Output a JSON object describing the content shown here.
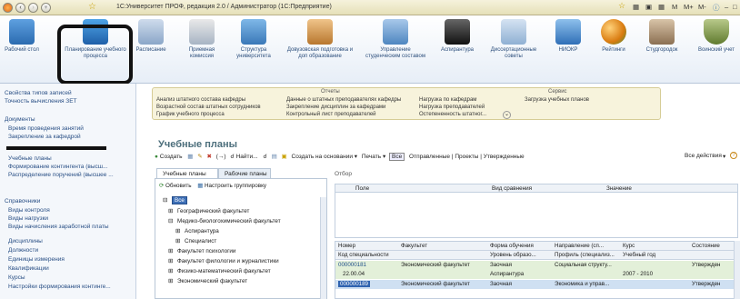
{
  "titlebar": {
    "title": "1С:Университет ПРОФ, редакция 2.0 / Администратор (1С:Предприятие)",
    "right_buttons": [
      "M",
      "M+",
      "M-"
    ]
  },
  "ribbon": {
    "items": [
      {
        "label": "Рабочий стол",
        "color": "#3b7bbf"
      },
      {
        "label": "Планирование учебного процесса",
        "color": "#2f78c4"
      },
      {
        "label": "Расписание",
        "color": "#6c8fb7"
      },
      {
        "label": "Приемная комиссия",
        "color": "#8a9db3"
      },
      {
        "label": "Структура университета",
        "color": "#4f8fbf"
      },
      {
        "label": "Довузовская подготовка и доп образование",
        "color": "#c98a3c"
      },
      {
        "label": "Управление студенческим составом",
        "color": "#6b97c7"
      },
      {
        "label": "Аспирантура",
        "color": "#333"
      },
      {
        "label": "Диссертационные советы",
        "color": "#7aa2c9"
      },
      {
        "label": "НИОКР",
        "color": "#4c8ac2"
      },
      {
        "label": "Рейтинги",
        "color": "#e08a1f"
      },
      {
        "label": "Студгородок",
        "color": "#7d6b5a"
      },
      {
        "label": "Воинский учет",
        "color": "#6b8f3c"
      }
    ]
  },
  "sidebar": {
    "top_links": [
      "Свойства типов записей",
      "Точность вычисления ЗЕТ"
    ],
    "documents_header": "Документы",
    "documents": [
      "Время проведения занятий",
      "Закрепление за кафедрой",
      "",
      "Учебные планы",
      "Формирование контингента (высш...",
      "Распределение поручений (высшее ..."
    ],
    "references_header": "Справочники",
    "references": [
      "Виды контроля",
      "Виды нагрузки",
      "Виды начисления заработной платы",
      "Дисциплины",
      "Должности",
      "Единицы измерения",
      "Квалификации",
      "Курсы",
      "Настройки формирования континге..."
    ]
  },
  "reports": {
    "header": "Отчеты",
    "col1": [
      "Анализ штатного состава кафедры",
      "Возрастной состав штатных сотрудников",
      "График учебного процесса"
    ],
    "col2": [
      "Данные о штатных преподавателях кафедры",
      "Закрепление дисциплин за кафедрами",
      "Контрольный лист преподавателей"
    ],
    "col3": [
      "Нагрузка по кафедрам",
      "Нагрузка преподавателей",
      "Остепененность штатног..."
    ],
    "service_header": "Сервис",
    "service": [
      "Загрузка учебных планов"
    ]
  },
  "main": {
    "title": "Учебные планы",
    "toolbar": {
      "create": "Создать",
      "find": "Найти...",
      "create_based": "Создать на основании",
      "print": "Печать",
      "all": "Все",
      "rejected": "Отправленные",
      "projects": "Проекты",
      "approved": "Утвержденные",
      "all_actions": "Все действия"
    },
    "tabs": [
      "Учебные планы",
      "Рабочие планы"
    ],
    "tree": {
      "refresh": "Обновить",
      "configure": "Настроить группировку",
      "rows": [
        {
          "label": "Все",
          "level": 0
        },
        {
          "label": "Географический факультет",
          "level": 1
        },
        {
          "label": "Медико-биологохимический факультет",
          "level": 1
        },
        {
          "label": "Аспирантура",
          "level": 2
        },
        {
          "label": "Специалист",
          "level": 2
        },
        {
          "label": "Факультет психологии",
          "level": 1
        },
        {
          "label": "Факультет филологии и журналистики",
          "level": 1
        },
        {
          "label": "Физико-математический факультет",
          "level": 1
        },
        {
          "label": "Экономический факультет",
          "level": 1
        }
      ]
    },
    "selection": {
      "label": "Отбор",
      "columns": [
        "Поле",
        "Вид сравнения",
        "Значение"
      ]
    },
    "list": {
      "columns": [
        "Номер",
        "Факультет",
        "Форма обучения",
        "Направление (сп...",
        "Курс",
        "Состояние"
      ],
      "subcolumns": [
        "Код специальности",
        "",
        "Уровень образо...",
        "Профиль (специализ...",
        "Учебный год",
        ""
      ],
      "rows": [
        [
          "000000181",
          "Экономический факультет",
          "Заочная",
          "Социальная структу...",
          "",
          "Утвержден"
        ],
        [
          "22.00.04",
          "",
          "Аспирантура",
          "",
          "2007 - 2010",
          ""
        ],
        [
          "000000189",
          "Экономический факультет",
          "Заочная",
          "Экономика и управ...",
          "",
          "Утвержден"
        ]
      ]
    }
  }
}
